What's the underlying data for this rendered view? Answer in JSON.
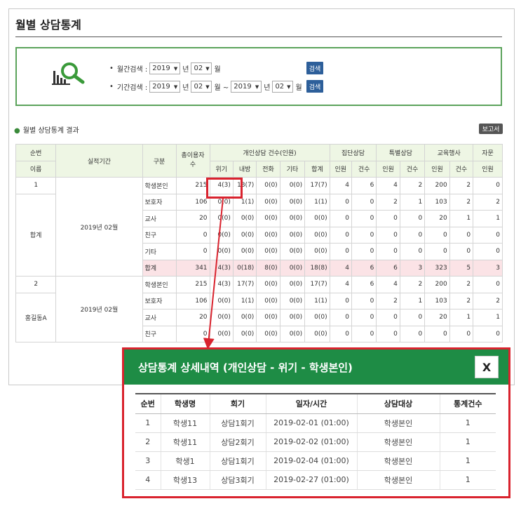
{
  "page": {
    "title": "월별 상담통계"
  },
  "search": {
    "monthly_label": "월간검색 :",
    "monthly_year": "2019",
    "monthly_month": "02",
    "period_label": "기간검색 :",
    "period_from_year": "2019",
    "period_from_month": "02",
    "period_to_year": "2019",
    "period_to_month": "02",
    "unit_year": "년",
    "unit_month": "월",
    "range_sep": "월 ~",
    "search_button": "검색",
    "bullet": "•"
  },
  "results": {
    "section_title": "월별 상담통계 결과",
    "report_button": "보고서"
  },
  "table": {
    "headers": {
      "seq": "순번",
      "name": "이름",
      "period": "실적기간",
      "category": "구분",
      "total_users": "총이용자수",
      "individual": "개인상담 건수(인원)",
      "group": "집단상담",
      "special": "특별상담",
      "education": "교육행사",
      "advice": "자문",
      "ind_sub": [
        "위기",
        "내방",
        "전화",
        "기타",
        "합계"
      ],
      "people": "인원",
      "count": "건수"
    },
    "groups": [
      {
        "seq": "1",
        "name": "합계",
        "period": "2019년 02월",
        "rows": [
          {
            "category": "학생본인",
            "total": "215",
            "v": [
              "4(3)",
              "13(7)",
              "0(0)",
              "0(0)",
              "17(7)",
              "4",
              "6",
              "4",
              "2",
              "200",
              "2",
              "0"
            ]
          },
          {
            "category": "보호자",
            "total": "106",
            "v": [
              "0(0)",
              "1(1)",
              "0(0)",
              "0(0)",
              "1(1)",
              "0",
              "0",
              "2",
              "1",
              "103",
              "2",
              "2"
            ]
          },
          {
            "category": "교사",
            "total": "20",
            "v": [
              "0(0)",
              "0(0)",
              "0(0)",
              "0(0)",
              "0(0)",
              "0",
              "0",
              "0",
              "0",
              "20",
              "1",
              "1"
            ]
          },
          {
            "category": "친구",
            "total": "0",
            "v": [
              "0(0)",
              "0(0)",
              "0(0)",
              "0(0)",
              "0(0)",
              "0",
              "0",
              "0",
              "0",
              "0",
              "0",
              "0"
            ]
          },
          {
            "category": "기타",
            "total": "0",
            "v": [
              "0(0)",
              "0(0)",
              "0(0)",
              "0(0)",
              "0(0)",
              "0",
              "0",
              "0",
              "0",
              "0",
              "0",
              "0"
            ]
          },
          {
            "category": "합계",
            "total": "341",
            "v": "total"
          }
        ]
      },
      {
        "seq": "2",
        "name": "홍길동A",
        "period": "2019년 02월",
        "rows": [
          {
            "category": "학생본인",
            "total": "215",
            "v": [
              "4(3)",
              "17(7)",
              "0(0)",
              "0(0)",
              "17(7)",
              "4",
              "6",
              "4",
              "2",
              "200",
              "2",
              "0"
            ]
          },
          {
            "category": "보호자",
            "total": "106",
            "v": [
              "0(0)",
              "1(1)",
              "0(0)",
              "0(0)",
              "1(1)",
              "0",
              "0",
              "2",
              "1",
              "103",
              "2",
              "2"
            ]
          },
          {
            "category": "교사",
            "total": "20",
            "v": [
              "0(0)",
              "0(0)",
              "0(0)",
              "0(0)",
              "0(0)",
              "0",
              "0",
              "0",
              "0",
              "20",
              "1",
              "1"
            ]
          },
          {
            "category": "친구",
            "total": "0",
            "v": [
              "0(0)",
              "0(0)",
              "0(0)",
              "0(0)",
              "0(0)",
              "0",
              "0",
              "0",
              "0",
              "0",
              "0",
              "0"
            ]
          }
        ]
      }
    ],
    "total_row_values": [
      "4(3)",
      "0(18)",
      "8(0)",
      "0(0)",
      "18(8)",
      "4",
      "6",
      "6",
      "3",
      "323",
      "5",
      "3"
    ]
  },
  "modal": {
    "title": "상담통계 상세내역 (개인상담 - 위기 - 학생본인)",
    "close_label": "X",
    "columns": [
      "순번",
      "학생명",
      "회기",
      "일자/시간",
      "상담대상",
      "통계건수"
    ],
    "rows": [
      [
        "1",
        "학생11",
        "상담1회기",
        "2019-02-01 (01:00)",
        "학생본인",
        "1"
      ],
      [
        "2",
        "학생11",
        "상담2회기",
        "2019-02-02 (01:00)",
        "학생본인",
        "1"
      ],
      [
        "3",
        "학생1",
        "상담1회기",
        "2019-02-04 (01:00)",
        "학생본인",
        "1"
      ],
      [
        "4",
        "학생13",
        "상담3회기",
        "2019-02-27 (01:00)",
        "학생본인",
        "1"
      ]
    ]
  },
  "colors": {
    "accent_green": "#1e8c45",
    "highlight_red": "#d9232e",
    "header_bg": "#eef6e4",
    "total_row_bg": "#fbe3e6",
    "button_blue": "#2d5f9a"
  },
  "icons": {
    "search_stats": "magnifier-chart-icon",
    "dropdown": "caret-down-icon"
  }
}
